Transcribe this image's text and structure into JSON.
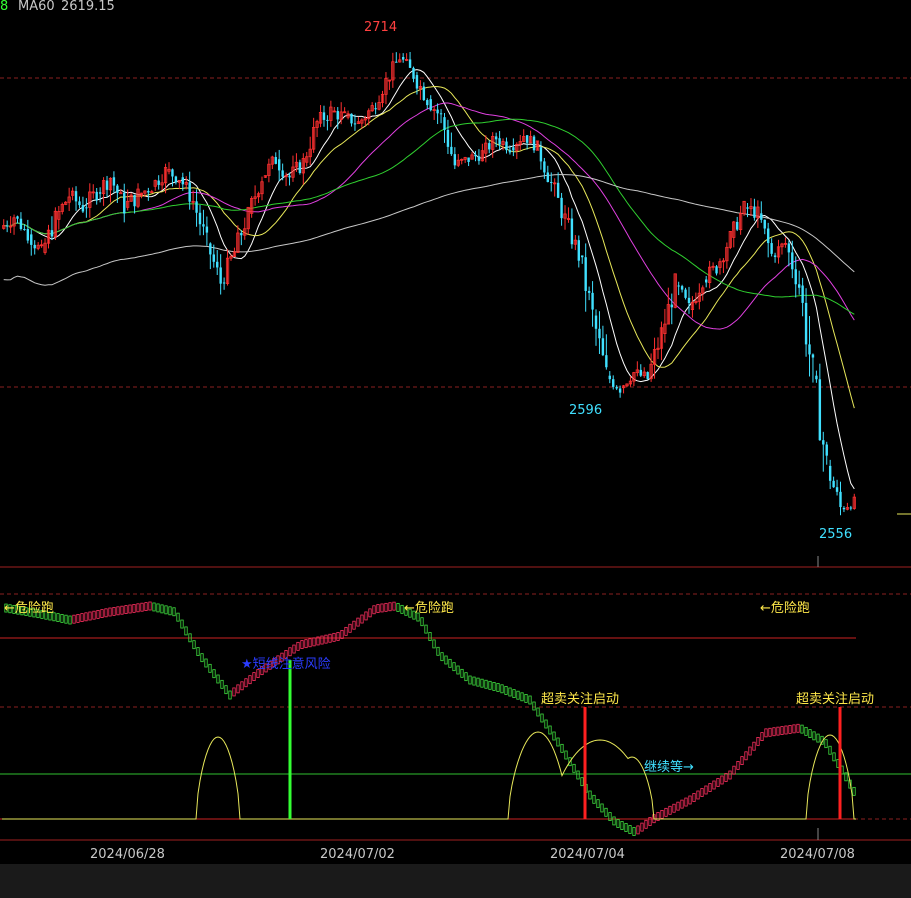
{
  "header": {
    "prefix": "8",
    "ma_label": "MA60",
    "ma_value": "2619.15"
  },
  "chart_data": {
    "type": "candlestick",
    "dates": [
      "2024/06/28",
      "2024/07/02",
      "2024/07/04",
      "2024/07/08"
    ],
    "price_labels": {
      "high": "2714",
      "low1": "2596",
      "low2": "2556"
    },
    "candles": [
      [
        2653,
        2660,
        2645,
        2657
      ],
      [
        2657,
        2661,
        2648,
        2651
      ],
      [
        2651,
        2655,
        2640,
        2645
      ],
      [
        2645,
        2660,
        2640,
        2656
      ],
      [
        2656,
        2668,
        2650,
        2664
      ],
      [
        2664,
        2670,
        2655,
        2660
      ],
      [
        2660,
        2668,
        2652,
        2665
      ],
      [
        2665,
        2675,
        2658,
        2670
      ],
      [
        2670,
        2672,
        2655,
        2660
      ],
      [
        2660,
        2668,
        2650,
        2664
      ],
      [
        2664,
        2670,
        2656,
        2667
      ],
      [
        2667,
        2675,
        2660,
        2672
      ],
      [
        2672,
        2680,
        2665,
        2670
      ],
      [
        2670,
        2674,
        2658,
        2662
      ],
      [
        2662,
        2666,
        2645,
        2648
      ],
      [
        2648,
        2650,
        2630,
        2635
      ],
      [
        2635,
        2648,
        2630,
        2645
      ],
      [
        2645,
        2660,
        2640,
        2658
      ],
      [
        2658,
        2672,
        2655,
        2670
      ],
      [
        2670,
        2680,
        2664,
        2676
      ],
      [
        2676,
        2682,
        2665,
        2670
      ],
      [
        2670,
        2678,
        2662,
        2675
      ],
      [
        2675,
        2690,
        2672,
        2688
      ],
      [
        2688,
        2696,
        2680,
        2692
      ],
      [
        2692,
        2700,
        2686,
        2690
      ],
      [
        2690,
        2694,
        2682,
        2688
      ],
      [
        2688,
        2695,
        2680,
        2693
      ],
      [
        2693,
        2705,
        2690,
        2702
      ],
      [
        2702,
        2712,
        2698,
        2710
      ],
      [
        2710,
        2714,
        2700,
        2704
      ],
      [
        2704,
        2708,
        2692,
        2696
      ],
      [
        2696,
        2700,
        2684,
        2690
      ],
      [
        2690,
        2692,
        2670,
        2674
      ],
      [
        2674,
        2680,
        2668,
        2676
      ],
      [
        2676,
        2682,
        2670,
        2678
      ],
      [
        2678,
        2685,
        2672,
        2683
      ],
      [
        2683,
        2688,
        2676,
        2680
      ],
      [
        2680,
        2686,
        2674,
        2684
      ],
      [
        2684,
        2688,
        2676,
        2680
      ],
      [
        2680,
        2682,
        2664,
        2668
      ],
      [
        2668,
        2672,
        2652,
        2656
      ],
      [
        2656,
        2660,
        2640,
        2644
      ],
      [
        2644,
        2648,
        2620,
        2624
      ],
      [
        2624,
        2628,
        2600,
        2604
      ],
      [
        2604,
        2610,
        2596,
        2600
      ],
      [
        2600,
        2608,
        2597,
        2605
      ],
      [
        2605,
        2612,
        2600,
        2603
      ],
      [
        2603,
        2622,
        2600,
        2618
      ],
      [
        2618,
        2638,
        2615,
        2634
      ],
      [
        2634,
        2640,
        2622,
        2626
      ],
      [
        2626,
        2638,
        2622,
        2636
      ],
      [
        2636,
        2645,
        2630,
        2640
      ],
      [
        2640,
        2652,
        2636,
        2650
      ],
      [
        2650,
        2662,
        2646,
        2660
      ],
      [
        2660,
        2664,
        2650,
        2658
      ],
      [
        2658,
        2662,
        2640,
        2644
      ],
      [
        2644,
        2650,
        2638,
        2648
      ],
      [
        2648,
        2652,
        2630,
        2634
      ],
      [
        2634,
        2640,
        2600,
        2604
      ],
      [
        2604,
        2608,
        2570,
        2574
      ],
      [
        2574,
        2576,
        2556,
        2560
      ],
      [
        2560,
        2566,
        2556,
        2562
      ]
    ],
    "ma_lines": [
      {
        "name": "MA5",
        "color": "#ffffff"
      },
      {
        "name": "MA10",
        "color": "#e8e85a"
      },
      {
        "name": "MA20",
        "color": "#e040e0"
      },
      {
        "name": "MA30",
        "color": "#30d030"
      },
      {
        "name": "MA60",
        "color": "#c8c8c8"
      }
    ],
    "indicator": {
      "labels": {
        "danger1": "←危险跑",
        "danger2": "←危险跑",
        "danger3": "←危险跑",
        "notice": "★短线注意风险",
        "oversold1": "超卖关注启动",
        "oversold2": "超卖关注启动",
        "wait": "继续等→"
      },
      "colors": {
        "rising": "#ff3060",
        "falling": "#40e040",
        "signal": "#e8e85a",
        "marker_green": "#33ff33",
        "marker_red": "#ff2020",
        "level_line": "#cc2222"
      }
    }
  }
}
